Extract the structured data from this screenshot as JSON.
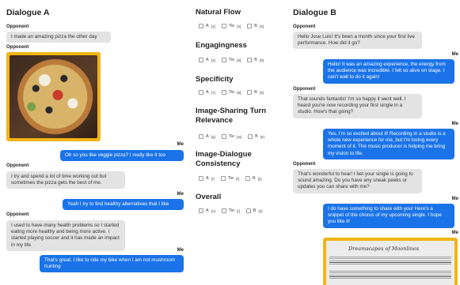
{
  "dialogue_a": {
    "title": "Dialogue A",
    "messages": [
      {
        "speaker": "Opponent",
        "text": "I made an amazing pizza the other day"
      },
      {
        "speaker": "Opponent",
        "image": "veggie-pizza-photo"
      },
      {
        "speaker": "Me",
        "text": "Oh so you like veggie pizza? I really like it too"
      },
      {
        "speaker": "Opponent",
        "text": "I try and spend a lot of time working out but sometimes the pizza gets the best of me."
      },
      {
        "speaker": "Me",
        "text": "Yeah I try to find healthy alternatives that I like"
      },
      {
        "speaker": "Opponent",
        "text": "I used to have many health problems so I started eating more healthy and being more active. I started playing soccer and it has made an impact in my life."
      },
      {
        "speaker": "Me",
        "text": "That's great. I like to ride my bike when I am not mushroom hunting"
      }
    ]
  },
  "ratings": {
    "questions": [
      {
        "title": "Natural Flow",
        "options": [
          "A",
          "Tie",
          "B"
        ],
        "sup": [
          "[1]",
          "[2]",
          "[3]"
        ]
      },
      {
        "title": "Engagingness",
        "options": [
          "A",
          "Tie",
          "B"
        ],
        "sup": [
          "[4]",
          "[5]",
          "[6]"
        ]
      },
      {
        "title": "Specificity",
        "options": [
          "A",
          "Tie",
          "B"
        ],
        "sup": [
          "[7]",
          "[8]",
          "[9]"
        ]
      },
      {
        "title": "Image-Sharing Turn Relevance",
        "options": [
          "A",
          "Tie",
          "B"
        ],
        "sup": [
          "[q]",
          "[w]",
          "[e]"
        ]
      },
      {
        "title": "Image-Dialogue Consistency",
        "options": [
          "A",
          "Tie",
          "B"
        ],
        "sup": [
          "[r]",
          "[t]",
          "[y]"
        ]
      },
      {
        "title": "Overall",
        "options": [
          "A",
          "Tie",
          "B"
        ],
        "sup": [
          "[u]",
          "[i]",
          "[o]"
        ]
      }
    ]
  },
  "dialogue_b": {
    "title": "Dialogue B",
    "messages": [
      {
        "speaker": "Opponent",
        "text": "Hello Jose Luis! It's been a month since your first live performance. How did it go?"
      },
      {
        "speaker": "Me",
        "text": "Hello! It was an amazing experience, the energy from the audience was incredible. I felt so alive on stage. I can't wait to do it again!"
      },
      {
        "speaker": "Opponent",
        "text": "That sounds fantastic! I'm so happy it went well. I heard you're now recording your first single in a studio. How's that going?"
      },
      {
        "speaker": "Me",
        "text": "Yes, I'm so excited about it! Recording in a studio is a whole new experience for me, but I'm loving every moment of it. The music producer is helping me bring my vision to life."
      },
      {
        "speaker": "Opponent",
        "text": "That's wonderful to hear! I bet your single is going to sound amazing. Do you have any sneak peeks or updates you can share with me?"
      },
      {
        "speaker": "Me",
        "text": "I do have something to share with you! Here's a snippet of the chorus of my upcoming single. I hope you like it!"
      },
      {
        "speaker": "Me",
        "image": "sheet-music-photo",
        "image_caption": "Dreamscapes of Moonlines"
      }
    ]
  },
  "colors": {
    "me_bubble": "#1a73e8",
    "opponent_bubble": "#e3e3e3",
    "image_frame": "#f2b417"
  }
}
